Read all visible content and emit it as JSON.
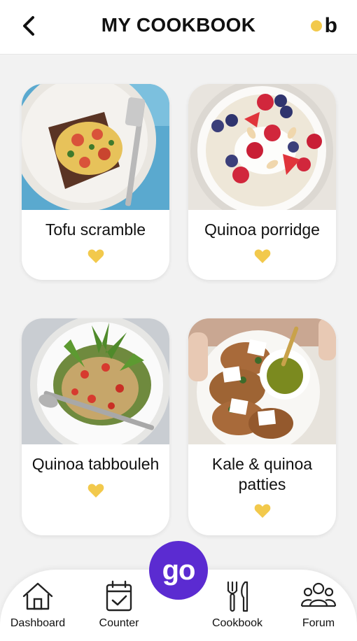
{
  "header": {
    "title": "MY COOKBOOK",
    "logo_letter": "b"
  },
  "colors": {
    "accent_yellow": "#F2C94C",
    "go_purple": "#5B2BD1"
  },
  "recipes": [
    {
      "name": "Tofu scramble",
      "favorite": true
    },
    {
      "name": "Quinoa porridge",
      "favorite": true
    },
    {
      "name": "Quinoa tabbouleh",
      "favorite": true
    },
    {
      "name": "Kale & quinoa patties",
      "favorite": true
    }
  ],
  "fab": {
    "label": "go"
  },
  "nav": [
    {
      "label": "Dashboard",
      "icon": "home-icon"
    },
    {
      "label": "Counter",
      "icon": "calendar-check-icon"
    },
    {
      "label": "Cookbook",
      "icon": "fork-knife-icon"
    },
    {
      "label": "Forum",
      "icon": "users-icon"
    }
  ]
}
